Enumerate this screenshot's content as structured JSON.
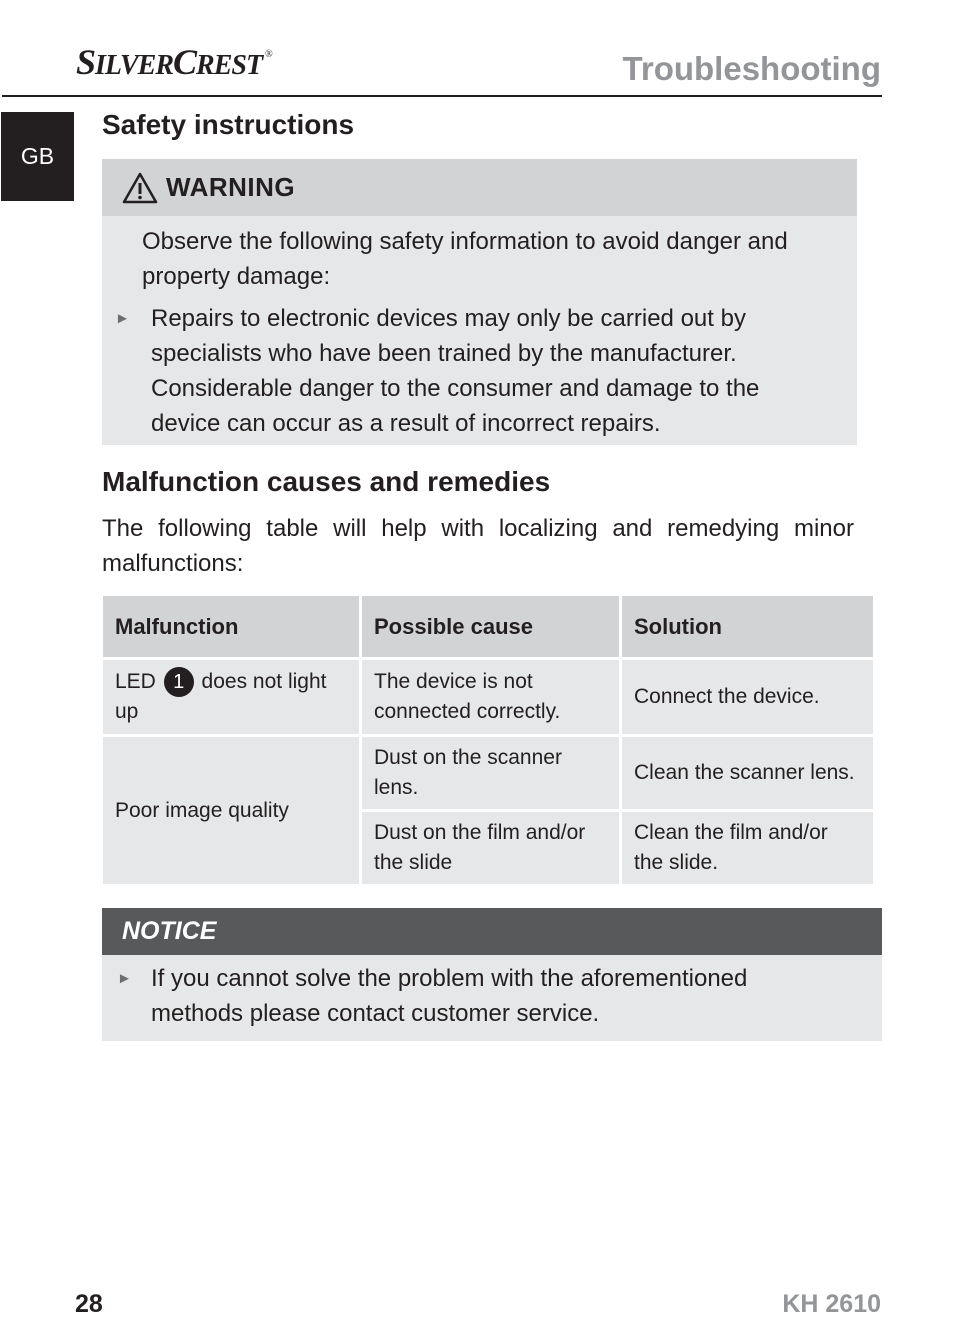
{
  "header": {
    "brand_first_cap": "S",
    "brand_first_rest": "ILVER",
    "brand_second_cap": "C",
    "brand_second_rest": "REST",
    "registered_mark": "®",
    "section_title": "Troubleshooting"
  },
  "language_tab": "GB",
  "safety": {
    "heading": "Safety instructions",
    "warning_label": "WARNING",
    "warning_icon": "warning-triangle-icon",
    "intro": "Observe the following safety information to avoid danger and property damage:",
    "bullets": [
      "Repairs to electronic devices may only be carried out by specialists who have been trained by the manufacturer. Considerable danger to the consumer and damage to the device can occur as a result of incorrect repairs."
    ]
  },
  "malfunctions": {
    "heading": "Malfunction causes and remedies",
    "intro": "The following table will help with localizing and remedying minor malfunctions:",
    "columns": [
      "Malfunction",
      "Possible cause",
      "Solution"
    ],
    "rows": [
      {
        "malfunction_prefix": "LED",
        "malfunction_ref": "1",
        "malfunction_suffix": "does not light up",
        "cause": "The device is not connected correctly.",
        "solution": "Connect the device."
      },
      {
        "malfunction": "Poor image quality",
        "cause": "Dust on the scanner lens.",
        "solution": "Clean the scanner lens."
      },
      {
        "cause": "Dust on the film and/or the slide",
        "solution": "Clean the film and/or the slide."
      }
    ]
  },
  "notice": {
    "label": "NOTICE",
    "bullets": [
      "If you cannot solve the problem with the aforementioned methods please contact customer service."
    ]
  },
  "footer": {
    "page_number": "28",
    "model": "KH 2610"
  },
  "colors": {
    "text": "#231f20",
    "header_gray": "#939598",
    "box_light": "#e6e7e8",
    "box_header": "#d1d3d4",
    "notice_header": "#58595b"
  }
}
